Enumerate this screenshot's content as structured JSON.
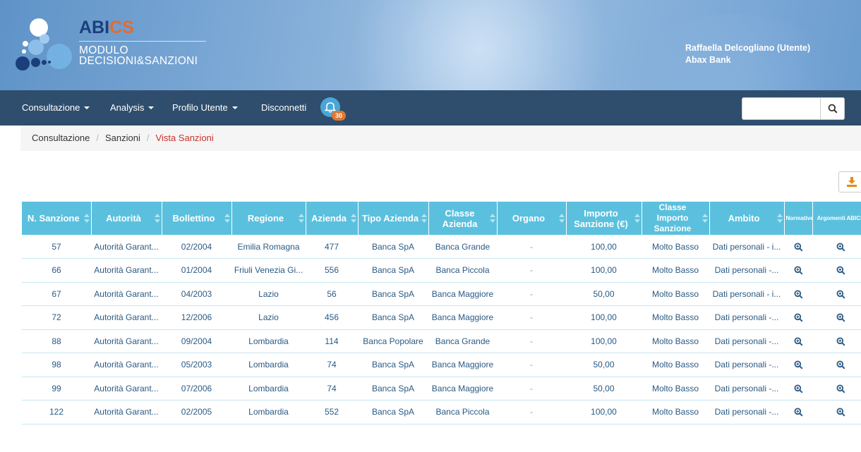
{
  "brand": {
    "abics_prefix": "ABI",
    "abics_suffix": "CS",
    "module_line1": "MODULO",
    "module_line2": "DECISIONI&SANZIONI"
  },
  "user": {
    "name": "Raffaella Delcogliano (Utente)",
    "bank": "Abax Bank"
  },
  "nav": {
    "items": [
      {
        "label": "Consultazione",
        "dropdown": true
      },
      {
        "label": "Analysis",
        "dropdown": true
      },
      {
        "label": "Profilo Utente",
        "dropdown": true
      },
      {
        "label": "Disconnetti",
        "dropdown": false
      }
    ],
    "notification_count": "30",
    "search_placeholder": ""
  },
  "breadcrumb": {
    "items": [
      "Consultazione",
      "Sanzioni"
    ],
    "active": "Vista Sanzioni"
  },
  "table": {
    "headers": [
      "N. Sanzione",
      "Autorità",
      "Bollettino",
      "Regione",
      "Azienda",
      "Tipo Azienda",
      "Classe Azienda",
      "Organo",
      "Importo Sanzione (€)",
      "Classe Importo Sanzione",
      "Ambito",
      "Normative",
      "Argomenti ABICS"
    ],
    "rows": [
      [
        "57",
        "Autorità Garant...",
        "02/2004",
        "Emilia Romagna",
        "477",
        "Banca SpA",
        "Banca Grande",
        "-",
        "100,00",
        "Molto Basso",
        "Dati personali - i..."
      ],
      [
        "66",
        "Autorità Garant...",
        "01/2004",
        "Friuli Venezia Gi...",
        "556",
        "Banca SpA",
        "Banca Piccola",
        "-",
        "100,00",
        "Molto Basso",
        "Dati personali -..."
      ],
      [
        "67",
        "Autorità Garant...",
        "04/2003",
        "Lazio",
        "56",
        "Banca SpA",
        "Banca Maggiore",
        "-",
        "50,00",
        "Molto Basso",
        "Dati personali - i..."
      ],
      [
        "72",
        "Autorità Garant...",
        "12/2006",
        "Lazio",
        "456",
        "Banca SpA",
        "Banca Maggiore",
        "-",
        "100,00",
        "Molto Basso",
        "Dati personali -..."
      ],
      [
        "88",
        "Autorità Garant...",
        "09/2004",
        "Lombardia",
        "114",
        "Banca Popolare",
        "Banca Grande",
        "-",
        "100,00",
        "Molto Basso",
        "Dati personali -..."
      ],
      [
        "98",
        "Autorità Garant...",
        "05/2003",
        "Lombardia",
        "74",
        "Banca SpA",
        "Banca Maggiore",
        "-",
        "50,00",
        "Molto Basso",
        "Dati personali -..."
      ],
      [
        "99",
        "Autorità Garant...",
        "07/2006",
        "Lombardia",
        "74",
        "Banca SpA",
        "Banca Maggiore",
        "-",
        "50,00",
        "Molto Basso",
        "Dati personali -..."
      ],
      [
        "122",
        "Autorità Garant...",
        "02/2005",
        "Lombardia",
        "552",
        "Banca SpA",
        "Banca Piccola",
        "-",
        "100,00",
        "Molto Basso",
        "Dati personali -..."
      ]
    ]
  },
  "colors": {
    "header_bg": "#5bc0de",
    "navbar_bg": "#2f4e6d",
    "link": "#2a5a84",
    "accent": "#e76a2e",
    "breadcrumb_active": "#c9302c"
  }
}
